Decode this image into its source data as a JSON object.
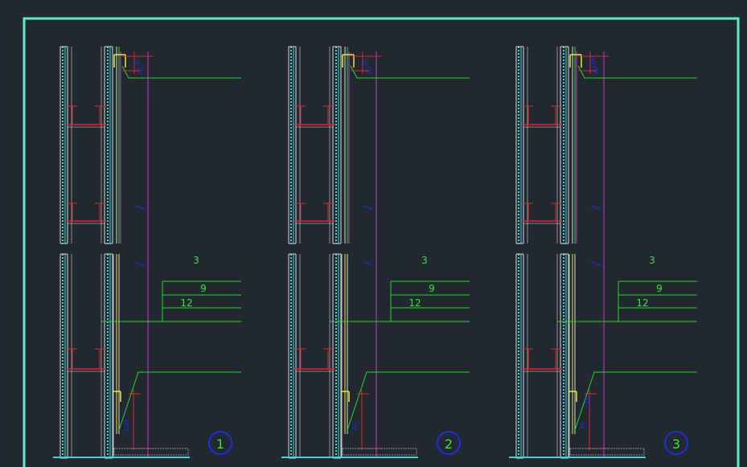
{
  "colors": {
    "background": "#212830",
    "frame": "#5ee8d0",
    "cyan": "#3fd6d6",
    "white_line": "#d8d8d8",
    "red": "#e0242c",
    "green": "#22d82a",
    "magenta": "#cc33cc",
    "yellow": "#e8e836",
    "blue": "#1a2ee0",
    "label_green": "#32e632"
  },
  "details": [
    {
      "number": "1",
      "labels": {
        "top": "3",
        "mid": "9",
        "bottom": "12"
      },
      "top_dims": [
        "30",
        "20"
      ],
      "bottom_dims": [
        "100"
      ]
    },
    {
      "number": "2",
      "labels": {
        "top": "3",
        "mid": "9",
        "bottom": "12"
      },
      "top_dims": [
        "30",
        "20"
      ],
      "bottom_dims": [
        "60"
      ]
    },
    {
      "number": "3",
      "labels": {
        "top": "3",
        "mid": "9",
        "bottom": "12"
      },
      "top_dims": [
        "100",
        "30"
      ],
      "bottom_dims": [
        "30",
        "100"
      ]
    }
  ]
}
